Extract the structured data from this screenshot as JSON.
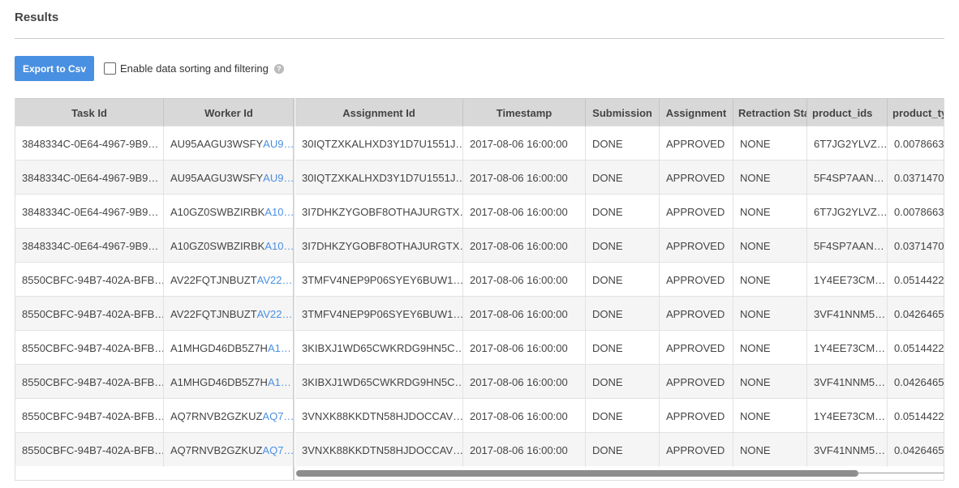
{
  "page": {
    "title": "Results"
  },
  "toolbar": {
    "export_label": "Export to Csv",
    "sort_filter_label": "Enable data sorting and filtering",
    "help_glyph": "?"
  },
  "table": {
    "pinned_headers": [
      "Task Id",
      "Worker Id"
    ],
    "headers": [
      "Assignment Id",
      "Timestamp",
      "Submission",
      "Assignment",
      "Retraction Stat",
      "product_ids",
      "product_typ"
    ],
    "rows": [
      {
        "task_id": "3848334C-0E64-4967-9B9…",
        "worker_id": "AU95AAGU3WSFY",
        "worker_id_link": "AU9…",
        "assignment_id": "30IQTZXKALHXD3Y1D7U1551J…",
        "timestamp": "2017-08-06 16:00:00",
        "submission": "DONE",
        "assignment": "APPROVED",
        "retraction": "NONE",
        "product_ids": "6T7JG2YLVZ…",
        "product_type": "0.0078663"
      },
      {
        "task_id": "3848334C-0E64-4967-9B9…",
        "worker_id": "AU95AAGU3WSFY",
        "worker_id_link": "AU9…",
        "assignment_id": "30IQTZXKALHXD3Y1D7U1551J…",
        "timestamp": "2017-08-06 16:00:00",
        "submission": "DONE",
        "assignment": "APPROVED",
        "retraction": "NONE",
        "product_ids": "5F4SP7AAN…",
        "product_type": "0.0371470"
      },
      {
        "task_id": "3848334C-0E64-4967-9B9…",
        "worker_id": "A10GZ0SWBZIRBK",
        "worker_id_link": "A10…",
        "assignment_id": "3I7DHKZYGOBF8OTHAJURGTX…",
        "timestamp": "2017-08-06 16:00:00",
        "submission": "DONE",
        "assignment": "APPROVED",
        "retraction": "NONE",
        "product_ids": "6T7JG2YLVZ…",
        "product_type": "0.0078663"
      },
      {
        "task_id": "3848334C-0E64-4967-9B9…",
        "worker_id": "A10GZ0SWBZIRBK",
        "worker_id_link": "A10…",
        "assignment_id": "3I7DHKZYGOBF8OTHAJURGTX…",
        "timestamp": "2017-08-06 16:00:00",
        "submission": "DONE",
        "assignment": "APPROVED",
        "retraction": "NONE",
        "product_ids": "5F4SP7AAN…",
        "product_type": "0.0371470"
      },
      {
        "task_id": "8550CBFC-94B7-402A-BFB…",
        "worker_id": "AV22FQTJNBUZT",
        "worker_id_link": "AV22…",
        "assignment_id": "3TMFV4NEP9P06SYEY6BUW1…",
        "timestamp": "2017-08-06 16:00:00",
        "submission": "DONE",
        "assignment": "APPROVED",
        "retraction": "NONE",
        "product_ids": "1Y4EE73CM…",
        "product_type": "0.0514422"
      },
      {
        "task_id": "8550CBFC-94B7-402A-BFB…",
        "worker_id": "AV22FQTJNBUZT",
        "worker_id_link": "AV22…",
        "assignment_id": "3TMFV4NEP9P06SYEY6BUW1…",
        "timestamp": "2017-08-06 16:00:00",
        "submission": "DONE",
        "assignment": "APPROVED",
        "retraction": "NONE",
        "product_ids": "3VF41NNM5…",
        "product_type": "0.0426465"
      },
      {
        "task_id": "8550CBFC-94B7-402A-BFB…",
        "worker_id": "A1MHGD46DB5Z7H",
        "worker_id_link": "A1…",
        "assignment_id": "3KIBXJ1WD65CWKRDG9HN5C…",
        "timestamp": "2017-08-06 16:00:00",
        "submission": "DONE",
        "assignment": "APPROVED",
        "retraction": "NONE",
        "product_ids": "1Y4EE73CM…",
        "product_type": "0.0514422"
      },
      {
        "task_id": "8550CBFC-94B7-402A-BFB…",
        "worker_id": "A1MHGD46DB5Z7H",
        "worker_id_link": "A1…",
        "assignment_id": "3KIBXJ1WD65CWKRDG9HN5C…",
        "timestamp": "2017-08-06 16:00:00",
        "submission": "DONE",
        "assignment": "APPROVED",
        "retraction": "NONE",
        "product_ids": "3VF41NNM5…",
        "product_type": "0.0426465"
      },
      {
        "task_id": "8550CBFC-94B7-402A-BFB…",
        "worker_id": "AQ7RNVB2GZKUZ",
        "worker_id_link": "AQ7…",
        "assignment_id": "3VNXK88KKDTN58HJDOCCAV…",
        "timestamp": "2017-08-06 16:00:00",
        "submission": "DONE",
        "assignment": "APPROVED",
        "retraction": "NONE",
        "product_ids": "1Y4EE73CM…",
        "product_type": "0.0514422"
      },
      {
        "task_id": "8550CBFC-94B7-402A-BFB…",
        "worker_id": "AQ7RNVB2GZKUZ",
        "worker_id_link": "AQ7…",
        "assignment_id": "3VNXK88KKDTN58HJDOCCAV…",
        "timestamp": "2017-08-06 16:00:00",
        "submission": "DONE",
        "assignment": "APPROVED",
        "retraction": "NONE",
        "product_ids": "3VF41NNM5…",
        "product_type": "0.0426465"
      }
    ]
  },
  "colors": {
    "accent": "#4a90e2",
    "header_bg": "#d8d8d8",
    "alt_row_bg": "#f5f5f5"
  }
}
